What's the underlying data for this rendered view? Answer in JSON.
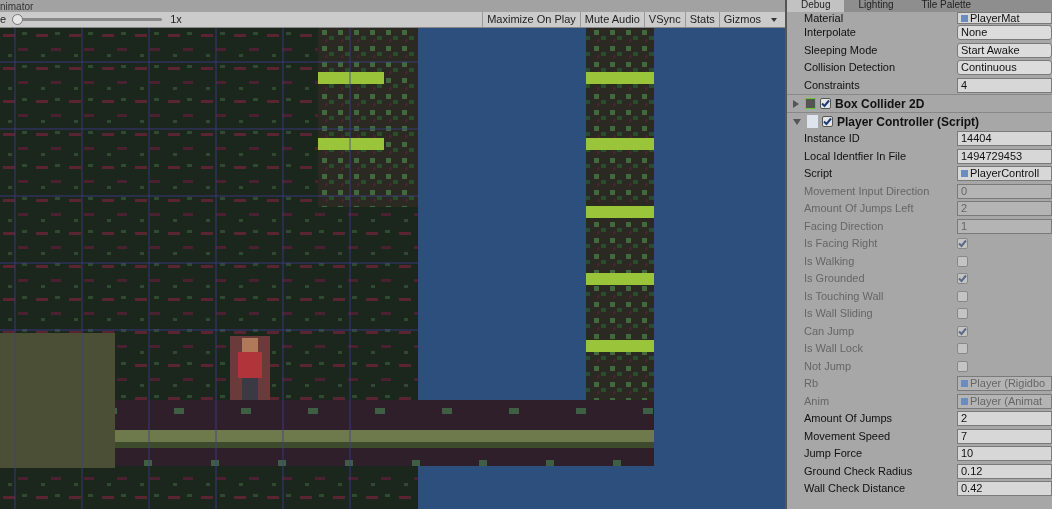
{
  "game_view": {
    "tab": "nimator",
    "scale_label": "e",
    "scale": {
      "level": 0.0
    },
    "scale_value": "1x",
    "toolbar": [
      {
        "label": "Maximize On Play",
        "on": false
      },
      {
        "label": "Mute Audio",
        "on": false
      },
      {
        "label": "VSync",
        "on": false
      },
      {
        "label": "Stats",
        "on": false
      },
      {
        "label": "Gizmos",
        "on": false,
        "dropdown": true
      }
    ]
  },
  "inspector": {
    "tabs": [
      {
        "label": "Debug",
        "selected": true
      },
      {
        "label": "Lighting",
        "selected": false
      },
      {
        "label": "Tile Palette",
        "selected": false
      }
    ],
    "rows": [
      {
        "kind": "object",
        "label": "Material",
        "value": "PlayerMat",
        "disabled": false
      },
      {
        "kind": "dropdown",
        "label": "Interpolate",
        "value": "None",
        "disabled": false
      },
      {
        "kind": "dropdown",
        "label": "Sleeping Mode",
        "value": "Start Awake",
        "disabled": false
      },
      {
        "kind": "dropdown",
        "label": "Collision Detection",
        "value": "Continuous",
        "disabled": false
      },
      {
        "kind": "field",
        "label": "Constraints",
        "value": "4",
        "disabled": false
      },
      {
        "kind": "component",
        "label": "Box Collider 2D",
        "expanded": false,
        "checked": true
      },
      {
        "kind": "component",
        "label": "Player Controller (Script)",
        "expanded": true,
        "checked": true
      },
      {
        "kind": "field",
        "label": "Instance ID",
        "value": "14404",
        "disabled": false
      },
      {
        "kind": "field",
        "label": "Local Identfier In File",
        "value": "1494729453",
        "disabled": false
      },
      {
        "kind": "object",
        "label": "Script",
        "value": "PlayerControll",
        "disabled": false
      },
      {
        "kind": "field",
        "label": "Movement Input Direction",
        "value": "0",
        "disabled": true
      },
      {
        "kind": "field",
        "label": "Amount Of Jumps Left",
        "value": "2",
        "disabled": true
      },
      {
        "kind": "field",
        "label": "Facing Direction",
        "value": "1",
        "disabled": true
      },
      {
        "kind": "checkbox",
        "label": "Is Facing Right",
        "checked": true,
        "disabled": true
      },
      {
        "kind": "checkbox",
        "label": "Is Walking",
        "checked": false,
        "disabled": true
      },
      {
        "kind": "checkbox",
        "label": "Is Grounded",
        "checked": true,
        "disabled": true
      },
      {
        "kind": "checkbox",
        "label": "Is Touching Wall",
        "checked": false,
        "disabled": true
      },
      {
        "kind": "checkbox",
        "label": "Is Wall Sliding",
        "checked": false,
        "disabled": true
      },
      {
        "kind": "checkbox",
        "label": "Can Jump",
        "checked": true,
        "disabled": true
      },
      {
        "kind": "checkbox",
        "label": "Is Wall Lock",
        "checked": false,
        "disabled": true
      },
      {
        "kind": "checkbox",
        "label": "Not Jump",
        "checked": false,
        "disabled": true
      },
      {
        "kind": "object",
        "label": "Rb",
        "value": "Player (Rigidbo",
        "disabled": true
      },
      {
        "kind": "object",
        "label": "Anim",
        "value": "Player (Animat",
        "disabled": true
      },
      {
        "kind": "field",
        "label": "Amount Of Jumps",
        "value": "2",
        "disabled": false
      },
      {
        "kind": "field",
        "label": "Movement Speed",
        "value": "7",
        "disabled": false
      },
      {
        "kind": "field",
        "label": "Jump Force",
        "value": "10",
        "disabled": false
      },
      {
        "kind": "field",
        "label": "Ground Check Radius",
        "value": "0.12",
        "disabled": false
      },
      {
        "kind": "field",
        "label": "Wall Check Distance",
        "value": "0.42",
        "disabled": false
      }
    ]
  }
}
